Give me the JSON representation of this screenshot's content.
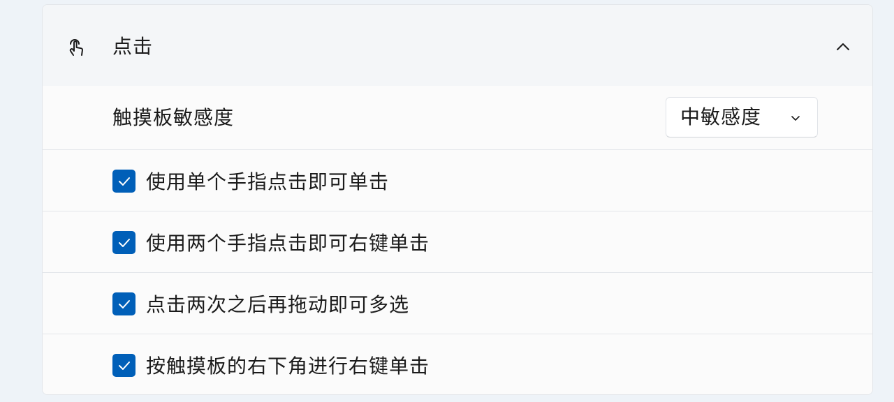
{
  "section": {
    "title": "点击",
    "icon": "tap-hand-icon",
    "collapse_icon": "chevron-up-icon"
  },
  "sensitivity": {
    "label": "触摸板敏感度",
    "selected": "中敏感度",
    "icon": "chevron-down-icon"
  },
  "options": [
    {
      "label": "使用单个手指点击即可单击",
      "checked": true
    },
    {
      "label": "使用两个手指点击即可右键单击",
      "checked": true
    },
    {
      "label": "点击两次之后再拖动即可多选",
      "checked": true
    },
    {
      "label": "按触摸板的右下角进行右键单击",
      "checked": true
    }
  ],
  "colors": {
    "accent": "#005fb8",
    "card_background": "#fbfbfb",
    "header_background": "#f4f6f8",
    "page_background": "#eef3f8"
  }
}
